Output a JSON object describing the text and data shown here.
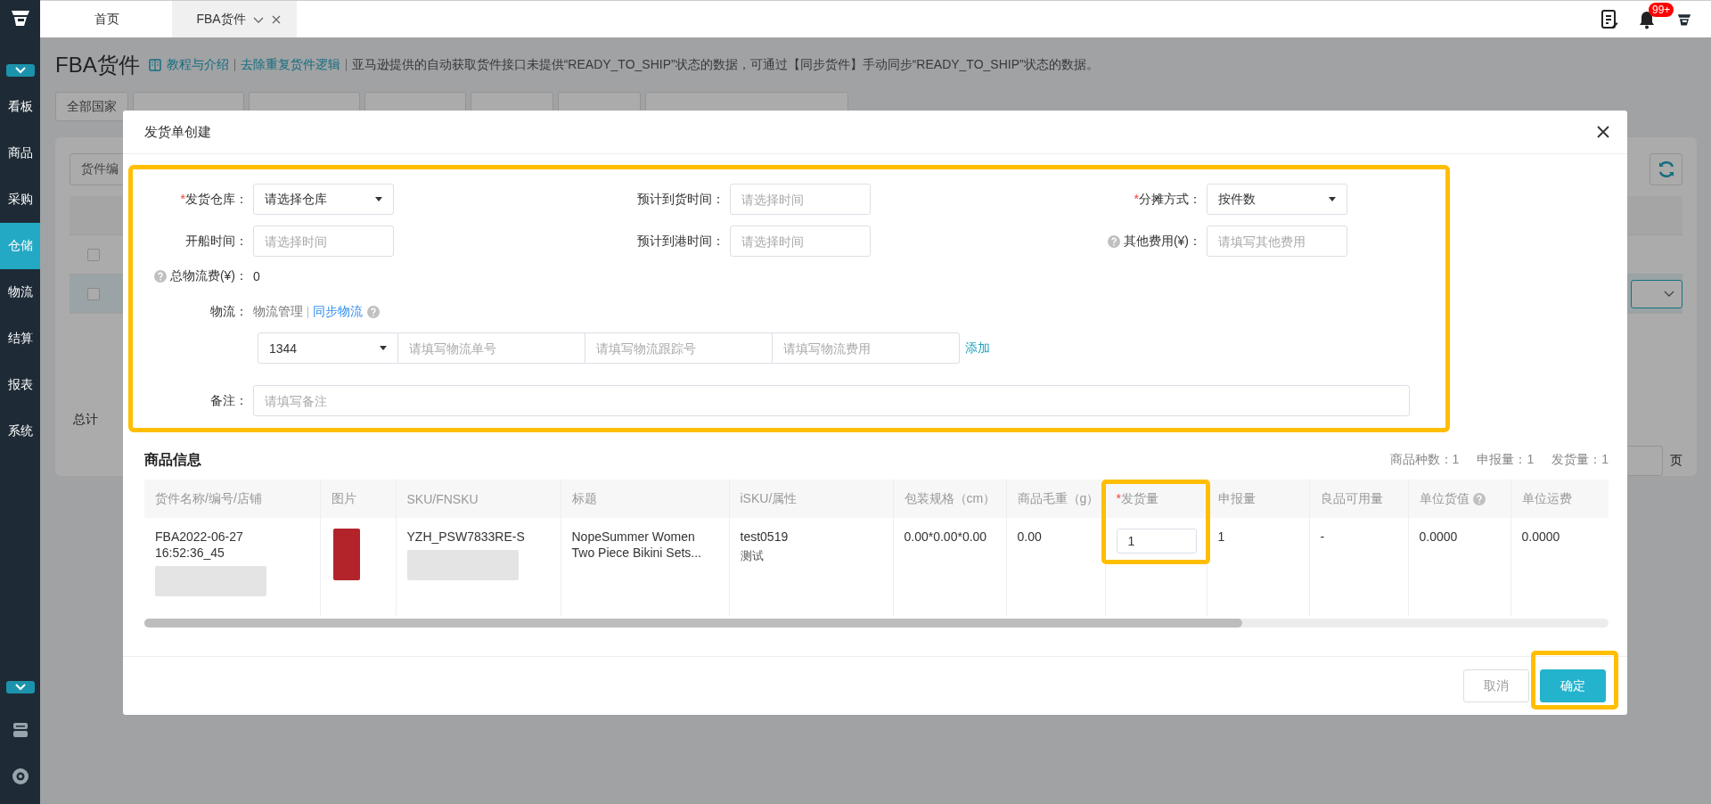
{
  "sidebar": {
    "items": [
      {
        "label": "看板",
        "selected": false
      },
      {
        "label": "商品",
        "selected": false
      },
      {
        "label": "采购",
        "selected": false
      },
      {
        "label": "仓储",
        "selected": true
      },
      {
        "label": "物流",
        "selected": false
      },
      {
        "label": "结算",
        "selected": false
      },
      {
        "label": "报表",
        "selected": false
      },
      {
        "label": "系统",
        "selected": false
      }
    ]
  },
  "tabs": [
    {
      "label": "首页",
      "selected": false,
      "closable": false
    },
    {
      "label": "FBA货件",
      "selected": true,
      "closable": true
    }
  ],
  "header": {
    "notification_badge": "99+"
  },
  "page": {
    "title": "FBA货件",
    "links": [
      "教程与介绍",
      "去除重复货件逻辑"
    ],
    "notice": "亚马逊提供的自动获取货件接口未提供“READY_TO_SHIP”状态的数据，可通过【同步货件】手动同步“READY_TO_SHIP”状态的数据。",
    "country_filter": "全部国家",
    "search_text": "货件编",
    "rows": [
      {
        "checked": false,
        "selected": false
      },
      {
        "checked": false,
        "selected": true
      }
    ],
    "total_label": "总计",
    "page_suffix": "页"
  },
  "dialog": {
    "title": "发货单创建",
    "form": {
      "highlighted": true,
      "fields": [
        {
          "label": "发货仓库：",
          "required_mark": "*",
          "help": false,
          "kind": "select",
          "value": "请选择仓库"
        },
        {
          "label": "预计到货时间：",
          "help": false,
          "kind": "input",
          "placeholder": "请选择时间"
        },
        {
          "label": "分摊方式：",
          "required_mark": "*",
          "help": false,
          "kind": "select",
          "value": "按件数"
        },
        {
          "label": "开船时间：",
          "help": false,
          "kind": "input",
          "placeholder": "请选择时间"
        },
        {
          "label": "预计到港时间：",
          "help": false,
          "kind": "input",
          "placeholder": "请选择时间"
        },
        {
          "label": "其他费用(¥)：",
          "help": true,
          "kind": "input",
          "placeholder": "请填写其他费用"
        }
      ],
      "total_fee": {
        "label": "总物流费(¥)：",
        "help": true,
        "value": "0"
      },
      "logistics": {
        "label": "物流：",
        "manage": "物流管理",
        "sync": "同步物流",
        "help": true,
        "carrier": "1344",
        "placeholders": [
          "请填写物流单号",
          "请填写物流跟踪号",
          "请填写物流费用"
        ],
        "add": "添加"
      },
      "remark": {
        "label": "备注：",
        "placeholder": "请填写备注"
      }
    },
    "products": {
      "title": "商品信息",
      "summary": [
        {
          "label": "商品种数：",
          "value": "1"
        },
        {
          "label": "申报量：",
          "value": "1"
        },
        {
          "label": "发货量：",
          "value": "1"
        }
      ],
      "columns": [
        {
          "label": "货件名称/编号/店铺",
          "help": false,
          "highlighted": false
        },
        {
          "label": "图片",
          "help": false,
          "highlighted": false
        },
        {
          "label": "SKU/FNSKU",
          "help": false,
          "highlighted": false
        },
        {
          "label": "标题",
          "help": false,
          "highlighted": false
        },
        {
          "label": "iSKU/属性",
          "help": false,
          "highlighted": false
        },
        {
          "label": "包装规格（cm）",
          "help": false,
          "highlighted": false
        },
        {
          "label": "商品毛重（g）",
          "help": false,
          "highlighted": false
        },
        {
          "label": "发货量",
          "required_mark": "*",
          "help": false,
          "highlighted": true
        },
        {
          "label": "申报量",
          "help": false,
          "highlighted": false
        },
        {
          "label": "良品可用量",
          "help": false,
          "highlighted": false
        },
        {
          "label": "单位货值",
          "help": true,
          "highlighted": false
        },
        {
          "label": "单位运费",
          "help": false,
          "highlighted": false
        }
      ],
      "rows": [
        {
          "cells": [
            {
              "kind": "text",
              "lines": [
                "FBA2022-06-27",
                "16:52:36_45"
              ],
              "blurred": true
            },
            {
              "kind": "image"
            },
            {
              "kind": "text",
              "lines": [
                "YZH_PSW7833RE-S"
              ],
              "blurred": true
            },
            {
              "kind": "text",
              "lines": [
                "NopeSummer Women",
                "Two Piece Bikini Sets..."
              ],
              "blurred": false
            },
            {
              "kind": "text",
              "lines": [
                "test0519"
              ],
              "note": "测试",
              "blurred": false
            },
            {
              "kind": "text",
              "lines": [
                "0.00*0.00*0.00"
              ],
              "blurred": false
            },
            {
              "kind": "text",
              "lines": [
                "0.00"
              ],
              "blurred": false
            },
            {
              "kind": "input",
              "value": "1"
            },
            {
              "kind": "text",
              "lines": [
                "1"
              ],
              "blurred": false
            },
            {
              "kind": "text",
              "lines": [
                "-"
              ],
              "blurred": false
            },
            {
              "kind": "text",
              "lines": [
                "0.0000"
              ],
              "blurred": false
            },
            {
              "kind": "text",
              "lines": [
                "0.0000"
              ],
              "blurred": false
            }
          ]
        }
      ]
    },
    "buttons": [
      {
        "label": "取消",
        "kind": "secondary",
        "highlighted": false
      },
      {
        "label": "确定",
        "kind": "primary",
        "highlighted": true
      }
    ]
  }
}
